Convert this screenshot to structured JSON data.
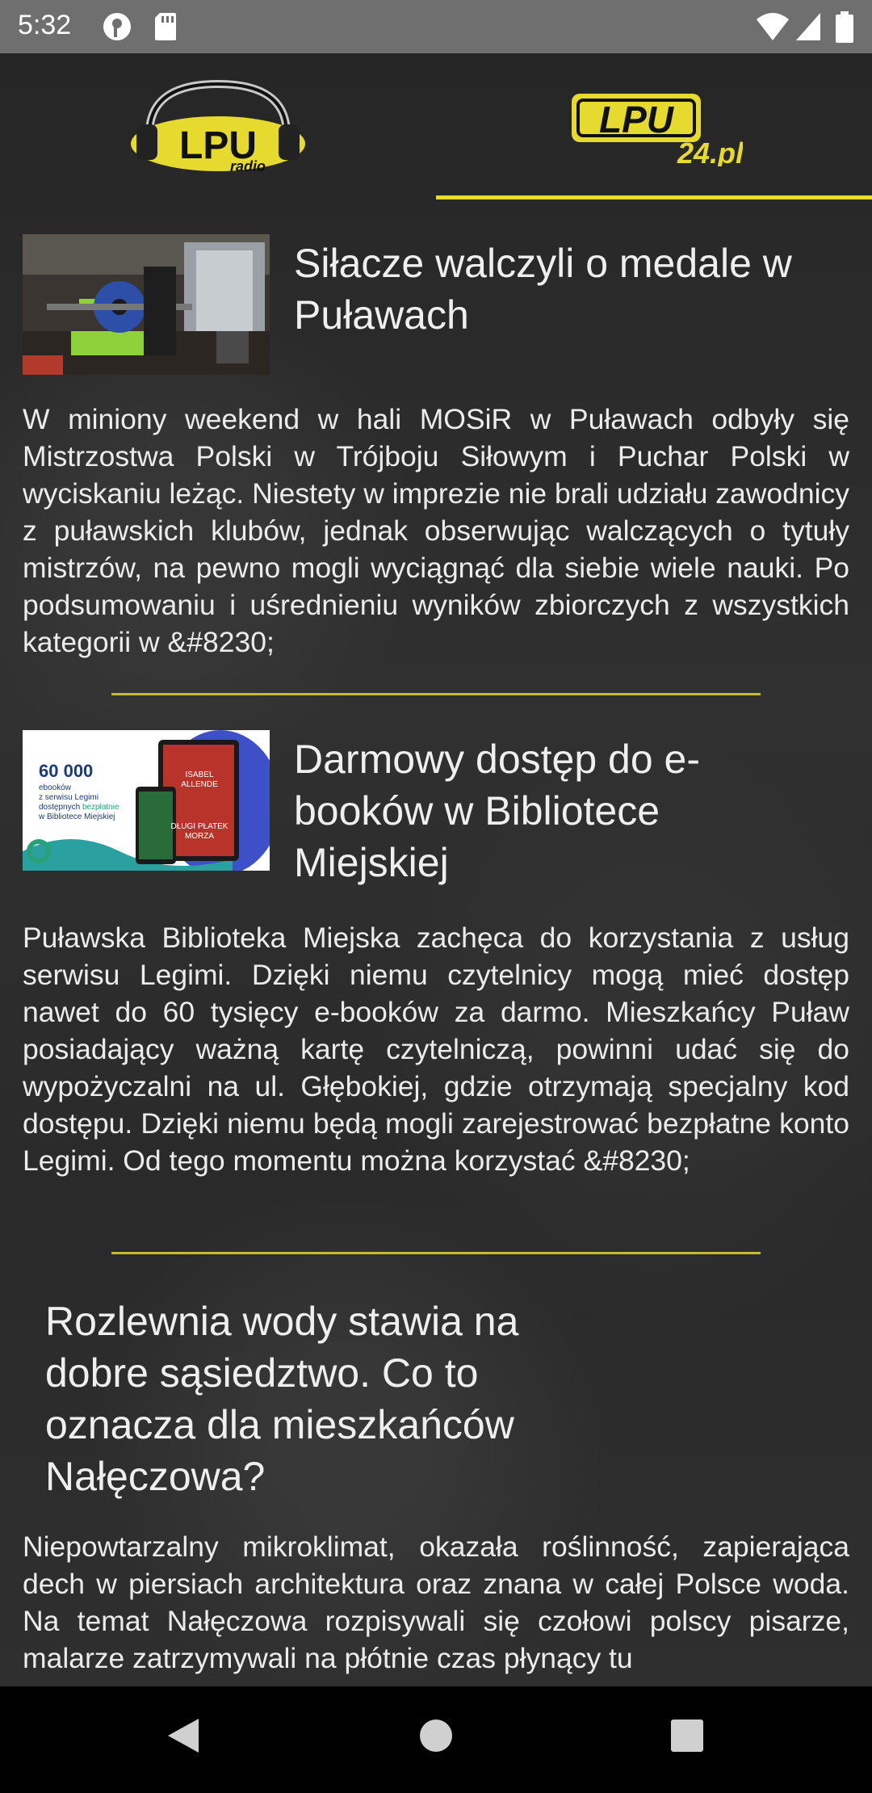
{
  "status_bar": {
    "time": "5:32"
  },
  "header": {
    "logo_left_text": "LPU",
    "logo_left_sub": "radio",
    "logo_right_text": "LPU",
    "logo_right_sub": "24.pl"
  },
  "articles": [
    {
      "title": "Siłacze walczyli o medale w Puławach",
      "excerpt": "W miniony weekend w hali MOSiR w Puławach odbyły się Mistrzostwa Polski w Trójboju Siłowym i Puchar Polski w wyciskaniu leżąc. Niestety w imprezie nie brali udziału zawodnicy z puławskich klubów, jednak obserwując walczących o tytuły mistrzów, na pewno mogli wyciągnąć dla siebie wiele nauki. Po podsumowaniu i uśrednieniu wyników zbiorczych z wszystkich kategorii w &#8230;"
    },
    {
      "title": "Darmowy dostęp do e-booków w Bibliotece Miejskiej",
      "excerpt": "Puławska Biblioteka Miejska zachęca do korzystania z usług serwisu Legimi. Dzięki niemu czytelnicy mogą mieć dostęp nawet do 60 tysięcy e-booków za darmo. Mieszkańcy Puław posiadający ważną kartę czytelniczą, powinni udać się do wypożyczalni na ul. Głębokiej, gdzie otrzymają specjalny kod dostępu. Dzięki niemu będą mogli zarejestrować bezpłatne konto Legimi. Od tego momentu można korzystać &#8230;",
      "thumb": {
        "big_number": "60 000",
        "line1": "ebooków",
        "line2": "z serwisu Legimi",
        "line3a": "dostępnych ",
        "line3b": "bezpłatnie",
        "line4": "w Bibliotece Miejskiej",
        "book_author": "ISABEL ALLENDE",
        "book_title": "DŁUGI PŁATEK MORZA"
      }
    },
    {
      "title": "Rozlewnia wody stawia na dobre sąsiedztwo. Co to oznacza dla mieszkańców Nałęczowa?",
      "excerpt": "Niepowtarzalny mikroklimat, okazała roślinność, zapierająca dech w piersiach architektura oraz znana w całej Polsce woda. Na temat Nałęczowa rozpisywali się czołowi polscy pisarze, malarze zatrzymywali na płótnie czas płynący tu"
    }
  ],
  "colors": {
    "accent_yellow": "#e6da2f",
    "background": "#2d2d2d"
  }
}
